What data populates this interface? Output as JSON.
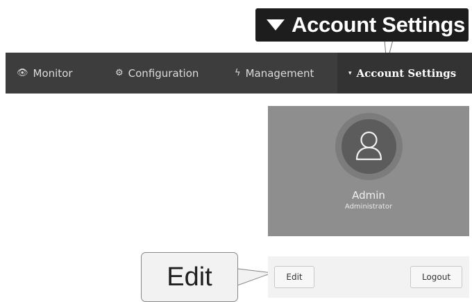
{
  "callouts": {
    "account_settings": "Account Settings",
    "edit": "Edit"
  },
  "navbar": {
    "items": [
      {
        "label": "Monitor",
        "icon": "eye-icon"
      },
      {
        "label": "Configuration",
        "icon": "gears-icon"
      },
      {
        "label": "Management",
        "icon": "bolt-icon"
      },
      {
        "label": "Account Settings",
        "icon": "caret-down-icon",
        "active": true
      }
    ]
  },
  "profile": {
    "name": "Admin",
    "role": "Administrator"
  },
  "footer": {
    "edit_label": "Edit",
    "logout_label": "Logout"
  },
  "colors": {
    "navbar_bg": "#3d3d3d",
    "navbar_active_bg": "#333333",
    "profile_bg": "#8e8e8e",
    "callout_dark": "#1d1d1d"
  }
}
